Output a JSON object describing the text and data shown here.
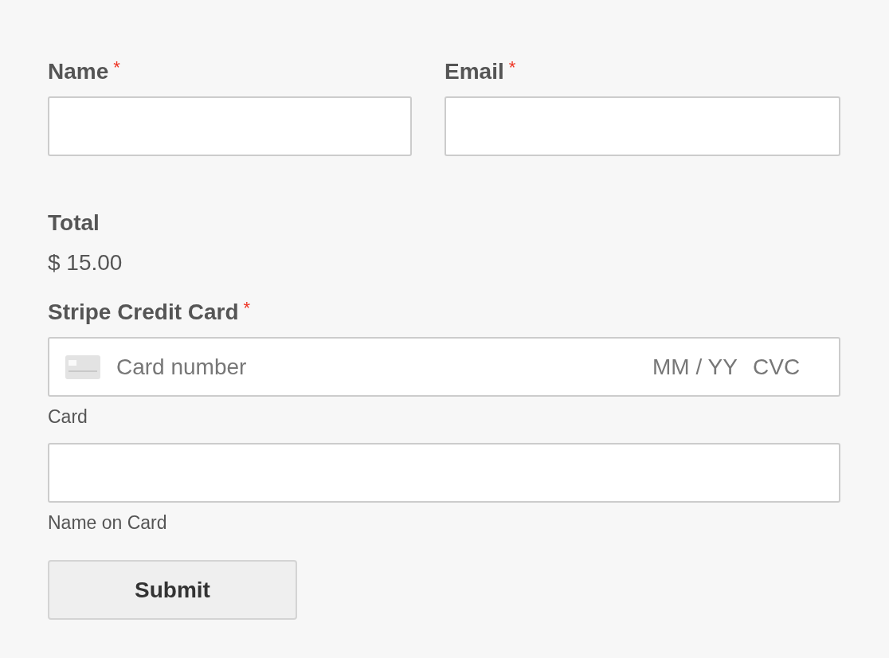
{
  "fields": [
    {
      "label": "Name",
      "required_mark": "*"
    },
    {
      "label": "Email",
      "required_mark": "*"
    }
  ],
  "total": {
    "label": "Total",
    "value": "$ 15.00"
  },
  "card": {
    "label": "Stripe Credit Card",
    "required_mark": "*",
    "number_placeholder": "Card number",
    "expiry_placeholder": "MM / YY",
    "cvc_placeholder": "CVC",
    "sublabel": "Card"
  },
  "name_on_card": {
    "sublabel": "Name on Card"
  },
  "submit": {
    "label": "Submit"
  }
}
